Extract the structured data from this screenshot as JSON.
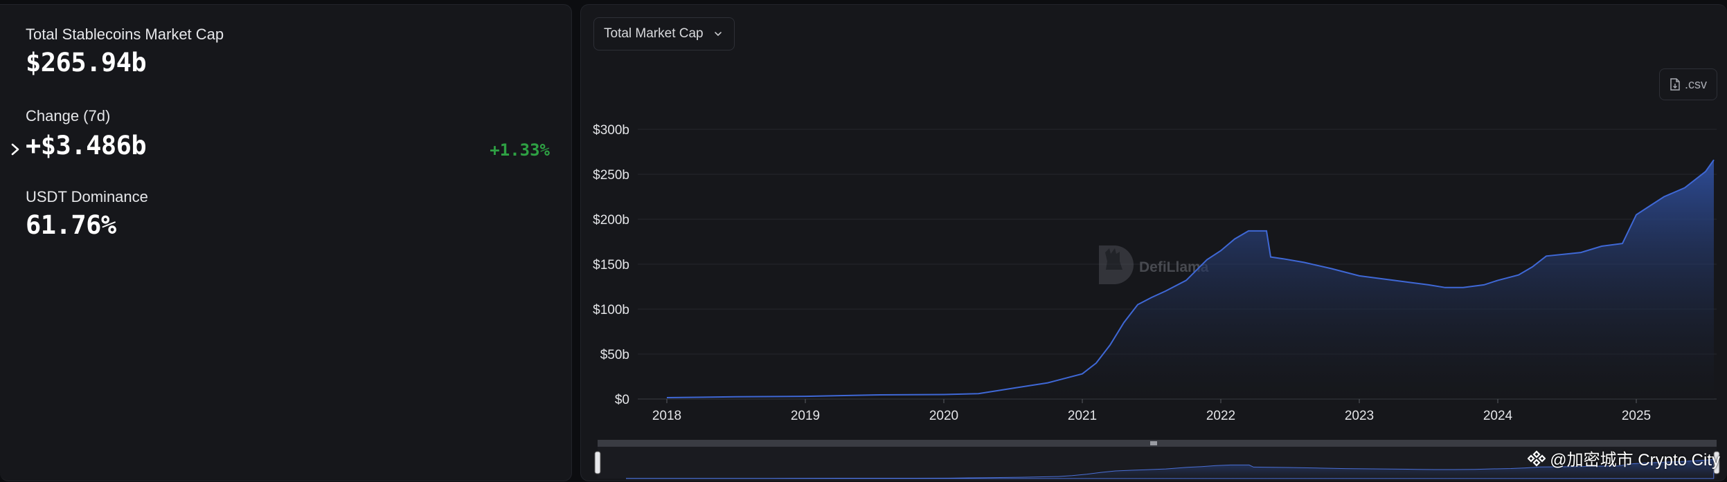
{
  "stats": {
    "market_cap_label": "Total Stablecoins Market Cap",
    "market_cap_value": "$265.94b",
    "change_label": "Change (7d)",
    "change_value": "+$3.486b",
    "change_percent": "+1.33%",
    "dominance_label": "USDT Dominance",
    "dominance_value": "61.76%"
  },
  "controls": {
    "metric_select": "Total Market Cap",
    "csv_label": ".csv"
  },
  "logo": {
    "text": "DefiLlama"
  },
  "watermark": {
    "text": "@加密城市 Crypto City"
  },
  "colors": {
    "positive": "#2ea043",
    "line": "#3f68d6",
    "grid": "#25272d"
  },
  "icons": {
    "expand": "chevron-right-icon",
    "select_caret": "chevron-down-icon",
    "csv": "file-icon"
  },
  "chart_data": {
    "type": "area",
    "y_ticks": [
      "$0",
      "$50b",
      "$100b",
      "$150b",
      "$200b",
      "$250b",
      "$300b"
    ],
    "x_ticks": [
      "2018",
      "2019",
      "2020",
      "2021",
      "2022",
      "2023",
      "2024",
      "2025"
    ],
    "ylim": [
      0,
      300
    ],
    "unit": "billions USD",
    "grid": true,
    "brush": true,
    "series": [
      {
        "x": [
          2018.0,
          2018.5,
          2019.0,
          2019.5,
          2020.0,
          2020.25,
          2020.5,
          2020.75,
          2021.0,
          2021.1,
          2021.2,
          2021.3,
          2021.4,
          2021.5,
          2021.6,
          2021.75,
          2021.9,
          2022.0,
          2022.1,
          2022.2,
          2022.33,
          2022.36,
          2022.45,
          2022.6,
          2022.8,
          2023.0,
          2023.25,
          2023.5,
          2023.62,
          2023.75,
          2023.9,
          2024.0,
          2024.15,
          2024.25,
          2024.35,
          2024.6,
          2024.75,
          2024.9,
          2025.0,
          2025.1,
          2025.2,
          2025.35,
          2025.5,
          2025.56
        ],
        "y": [
          1.5,
          2.5,
          3,
          4.5,
          5,
          6,
          12,
          18,
          28,
          40,
          60,
          85,
          105,
          113,
          120,
          132,
          155,
          165,
          178,
          187,
          187,
          158,
          156,
          152,
          145,
          137,
          132,
          127,
          124,
          124,
          127,
          132,
          138,
          147,
          159,
          163,
          170,
          173,
          205,
          215,
          225,
          235,
          253,
          266
        ]
      }
    ]
  }
}
